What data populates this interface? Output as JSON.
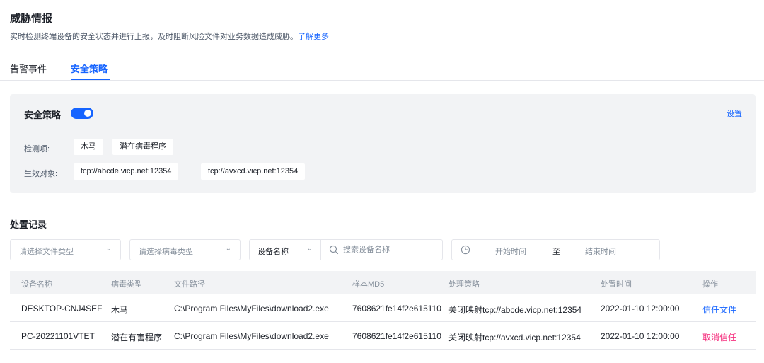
{
  "header": {
    "title": "威胁情报",
    "description": "实时检测终端设备的安全状态并进行上报，及时阻断风险文件对业务数据造成威胁。",
    "learn_more": "了解更多"
  },
  "tabs": [
    {
      "label": "告警事件",
      "active": false
    },
    {
      "label": "安全策略",
      "active": true
    }
  ],
  "policy": {
    "title": "安全策略",
    "enabled": true,
    "settings_label": "设置",
    "detect_label": "检测项:",
    "detect_items": [
      "木马",
      "潜在病毒程序"
    ],
    "target_label": "生效对象:",
    "targets": [
      "tcp://abcde.vicp.net:12354",
      "tcp://avxcd.vicp.net:12354"
    ]
  },
  "records": {
    "title": "处置记录",
    "filters": {
      "file_type_placeholder": "请选择文件类型",
      "virus_type_placeholder": "请选择病毒类型",
      "device_field": "设备名称",
      "search_placeholder": "搜索设备名称",
      "start_time": "开始时间",
      "range_sep": "至",
      "end_time": "结束时间"
    },
    "columns": [
      "设备名称",
      "病毒类型",
      "文件路径",
      "样本MD5",
      "处理策略",
      "处置时间",
      "操作"
    ],
    "rows": [
      {
        "device": "DESKTOP-CNJ4SEF",
        "virus": "木马",
        "path": "C:\\Program Files\\MyFiles\\download2.exe",
        "md5": "7608621fe14f2e615110",
        "policy": "关闭映射tcp://abcde.vicp.net:12354",
        "time": "2022-01-10 12:00:00",
        "action": "信任文件"
      },
      {
        "device": "PC-20221101VTET",
        "virus": "潜在有害程序",
        "path": "C:\\Program Files\\MyFiles\\download2.exe",
        "md5": "7608621fe14f2e615110",
        "policy": "关闭映射tcp://avxcd.vicp.net:12354",
        "time": "2022-01-10 12:00:00",
        "action": "取消信任"
      }
    ]
  },
  "colors": {
    "primary": "#1664ff",
    "danger": "#f5317f",
    "card_bg": "#f2f3f5"
  }
}
